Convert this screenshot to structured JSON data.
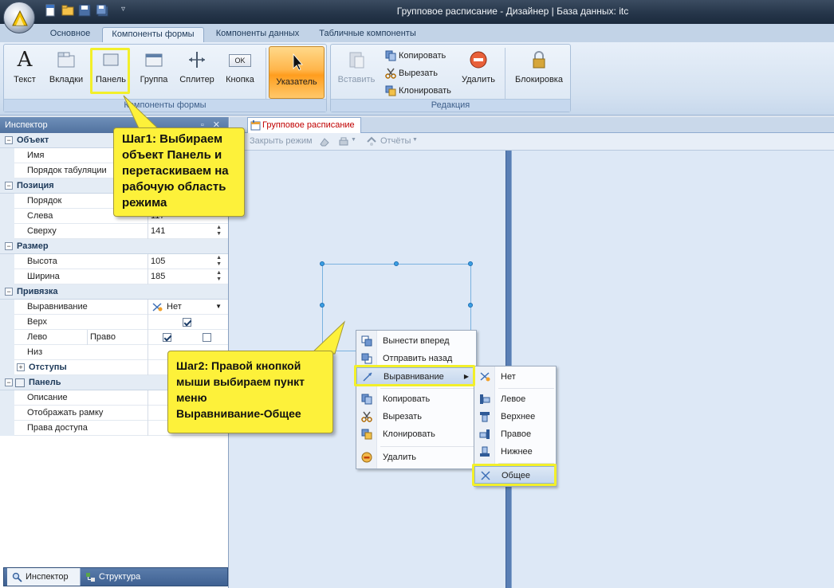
{
  "window": {
    "title": "Групповое расписание - Дизайнер | База данных: itc"
  },
  "tabs": [
    "Основное",
    "Компоненты формы",
    "Компоненты данных",
    "Табличные компоненты"
  ],
  "ribbon": {
    "form_components": {
      "group_label": "Компоненты формы",
      "buttons": [
        "Текст",
        "Вкладки",
        "Панель",
        "Группа",
        "Сплитер",
        "Кнопка"
      ],
      "button_ok_glyph": "OK",
      "pointer_label": "Указатель"
    },
    "edit": {
      "group_label": "Редакция",
      "paste": "Вставить",
      "copy": "Копировать",
      "cut": "Вырезать",
      "clone": "Клонировать",
      "delete": "Удалить",
      "lock": "Блокировка"
    }
  },
  "inspector": {
    "title": "Инспектор",
    "rows": {
      "object": "Объект",
      "name": "Имя",
      "tab_order": "Порядок табуляции",
      "position": "Позиция",
      "order": "Порядок",
      "left": "Слева",
      "left_value": "117",
      "top": "Сверху",
      "top_value": "141",
      "size": "Размер",
      "height": "Высота",
      "height_value": "105",
      "width": "Ширина",
      "width_value": "185",
      "anchor": "Привязка",
      "align": "Выравнивание",
      "align_value": "Нет",
      "top_anchor": "Верх",
      "left_anchor": "Лево",
      "right_anchor": "Право",
      "bottom_anchor": "Низ",
      "padding": "Отступы",
      "panel": "Панель",
      "description": "Описание",
      "show_border": "Отображать рамку",
      "access": "Права доступа"
    },
    "bottom_tabs": [
      "Инспектор",
      "Структура"
    ]
  },
  "document": {
    "tab": "Групповое расписание",
    "toolbar": {
      "close_mode": "Закрыть режим",
      "reports": "Отчёты"
    }
  },
  "context_menu": {
    "items": [
      "Вынести вперед",
      "Отправить назад",
      "Выравнивание",
      "Копировать",
      "Вырезать",
      "Клонировать",
      "Удалить"
    ],
    "submenu": [
      "Нет",
      "Левое",
      "Верхнее",
      "Правое",
      "Нижнее",
      "Общее"
    ]
  },
  "callouts": {
    "step1": [
      "Шаг1: Выбираем",
      "объект Панель и",
      "перетаскиваем на",
      "рабочую область",
      "режима"
    ],
    "step2": [
      "Шаг2: Правой кнопкой",
      "мыши выбираем пункт",
      "меню",
      "Выравнивание-Общее"
    ]
  },
  "colors": {
    "highlight": "#f2ef2a",
    "callout": "#fdf13a",
    "doc_tab_text": "#c00000"
  }
}
